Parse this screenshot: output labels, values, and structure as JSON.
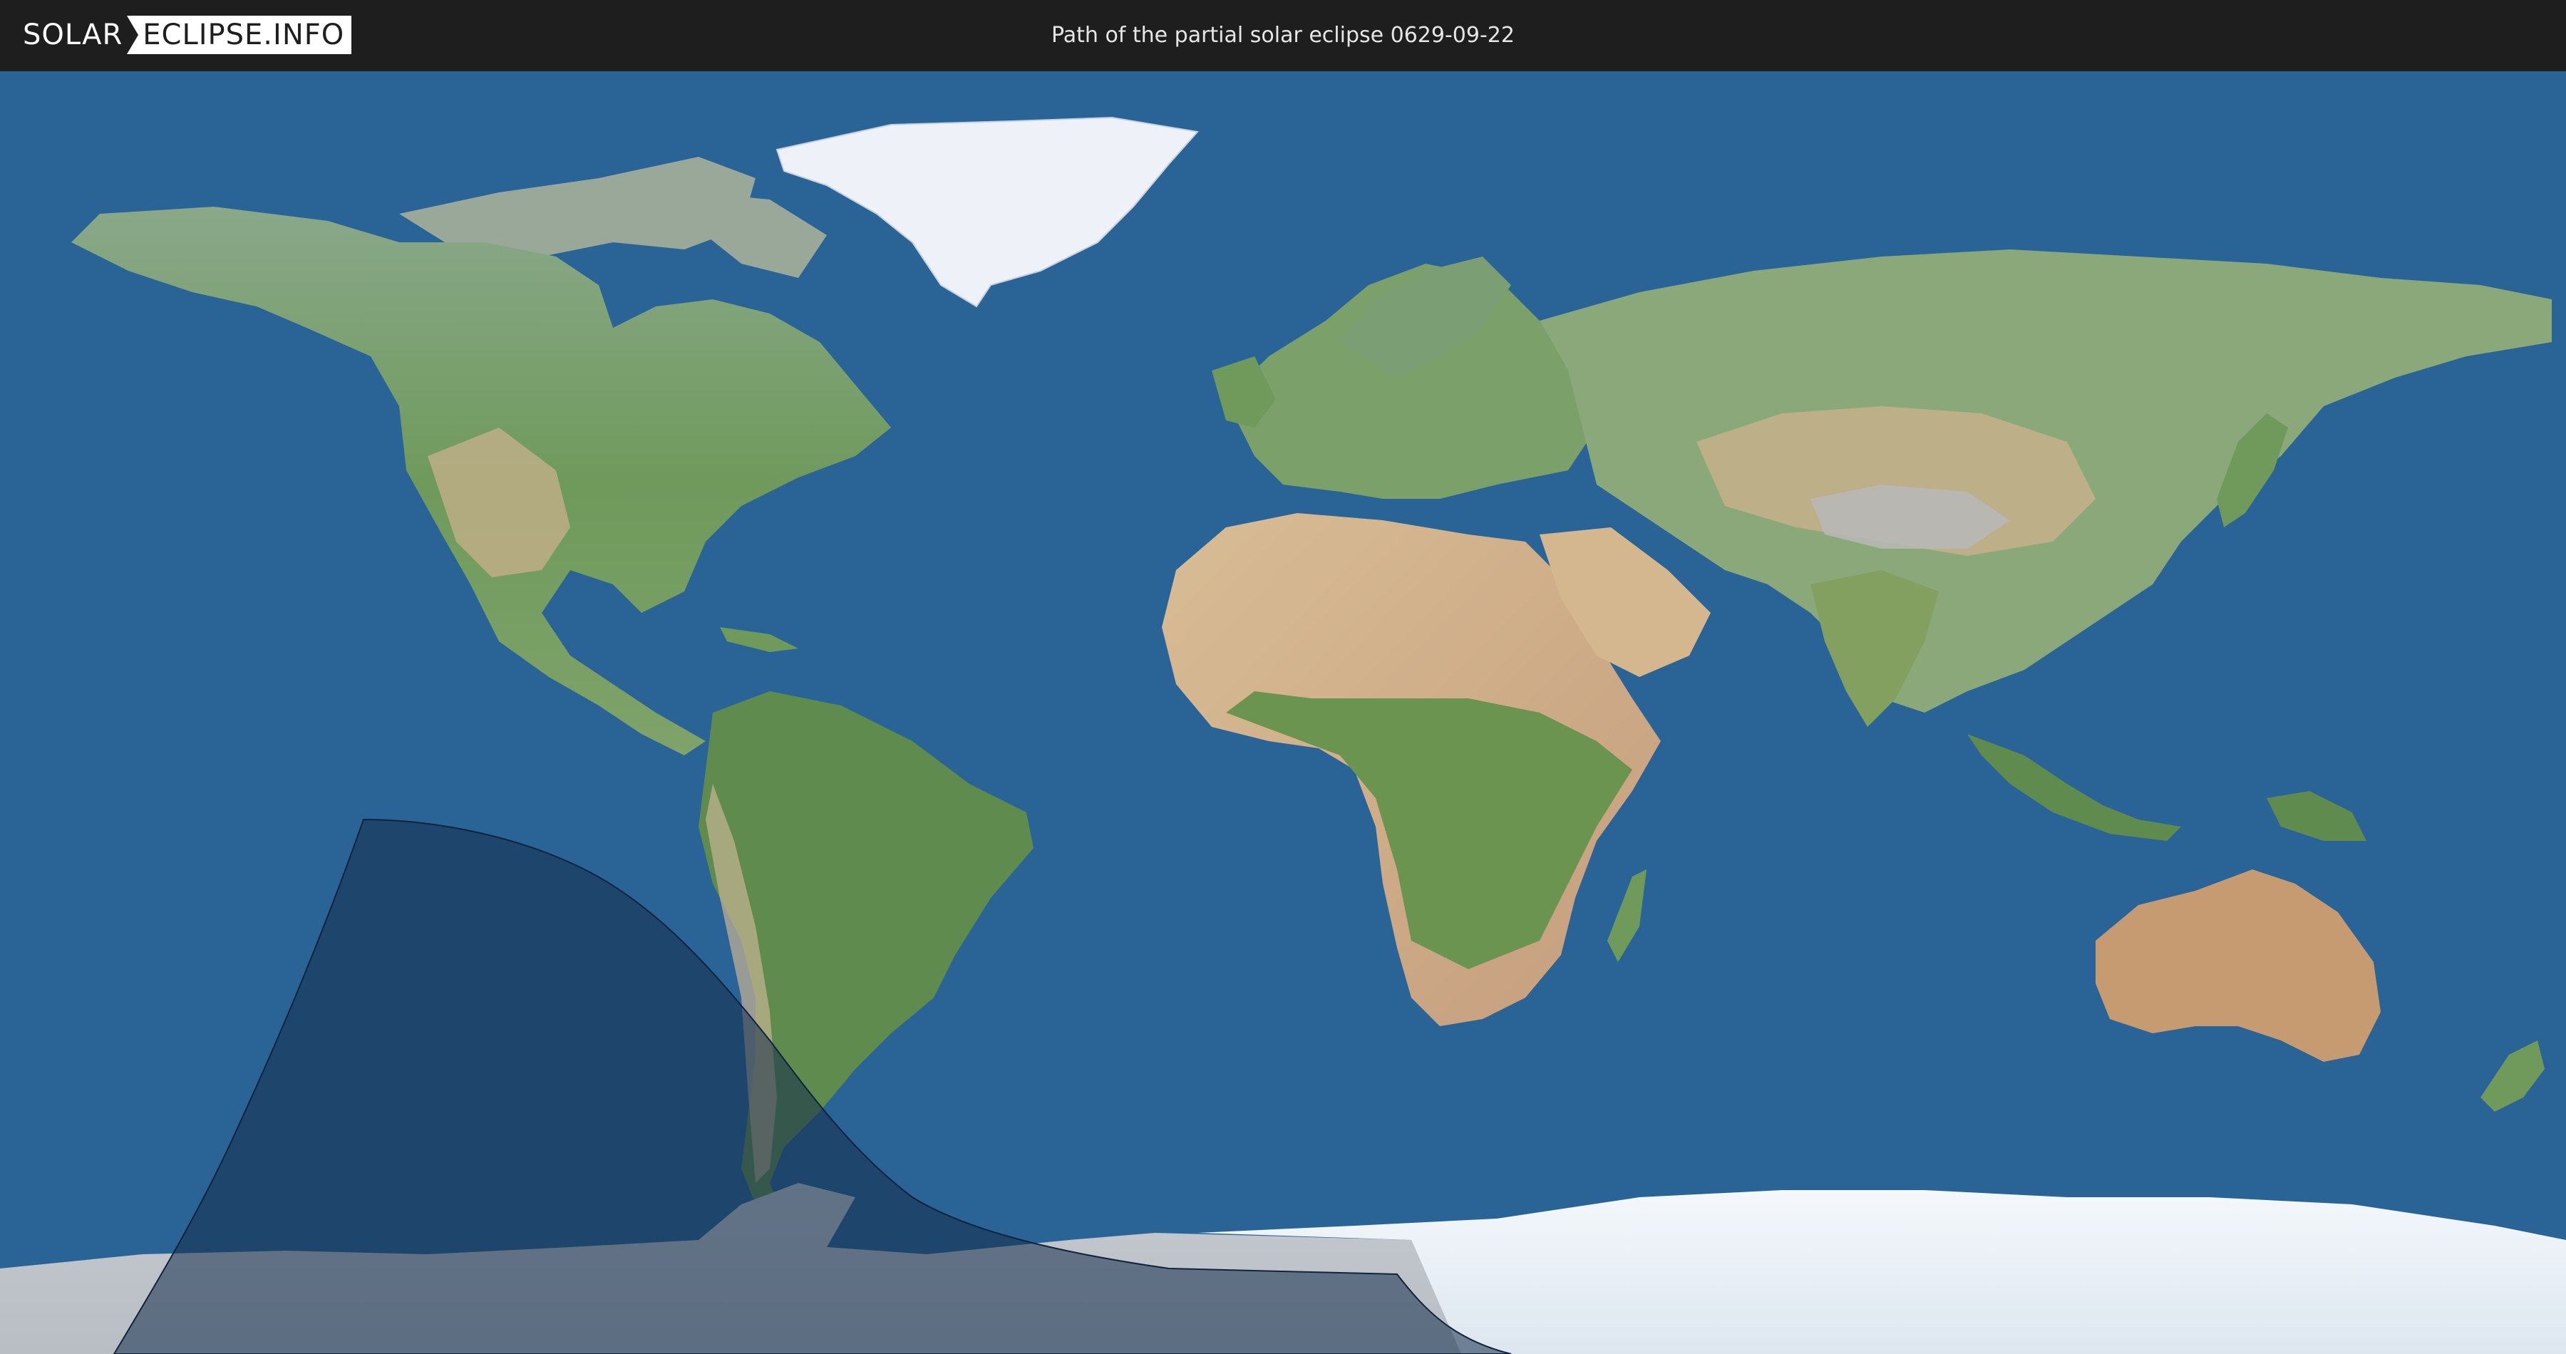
{
  "header": {
    "logo_part1": "SOLAR",
    "logo_part2": "ECLIPSE.INFO",
    "title": "Path of the partial solar eclipse 0629-09-22"
  },
  "colors": {
    "header_bg": "#1e1e1e",
    "ocean": "#2a6496",
    "shadow": "#1d3f63",
    "ice": "#eef3f8",
    "land_green": "#6e9a5e",
    "land_desert": "#cbb08a"
  },
  "icons": {
    "logo_separator": "arrow-chevron-icon"
  }
}
